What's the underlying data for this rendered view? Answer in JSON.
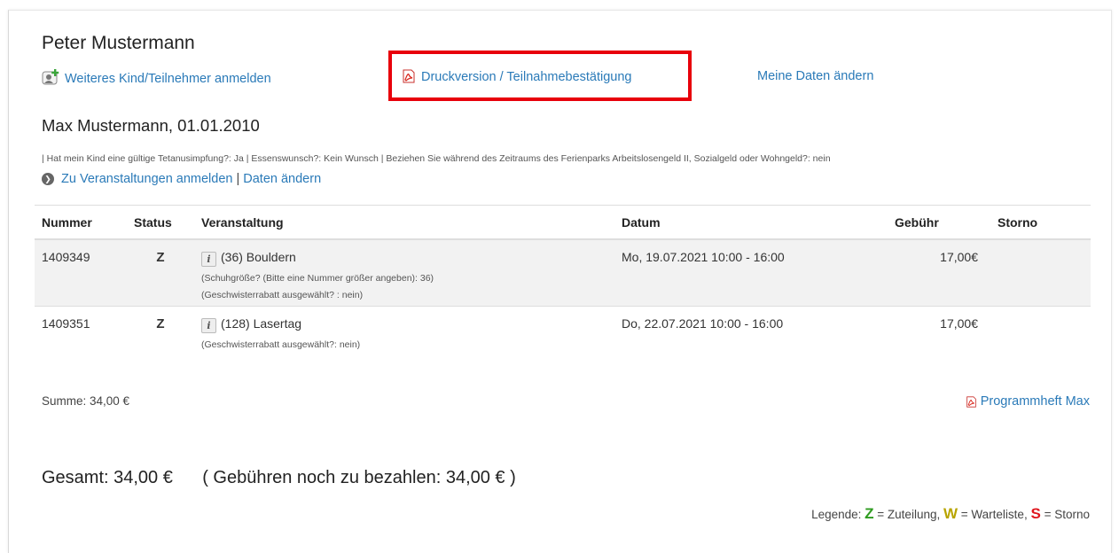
{
  "parent": {
    "name": "Peter Mustermann",
    "actions": {
      "add_child": "Weiteres Kind/Teilnehmer anmelden",
      "print": "Druckversion / Teilnahmebestätigung",
      "my_data": "Meine Daten ändern"
    }
  },
  "child": {
    "name": "Max Mustermann, 01.01.2010",
    "info": "| Hat mein Kind eine gültige Tetanusimpfung?: Ja | Essenswunsch?: Kein Wunsch | Beziehen Sie während des Zeitraums des Ferienparks Arbeitslosengeld II, Sozialgeld oder Wohngeld?: nein",
    "link_register": "Zu Veranstaltungen anmelden",
    "link_separator": "|",
    "link_edit": "Daten ändern"
  },
  "table": {
    "headers": {
      "nummer": "Nummer",
      "status": "Status",
      "veranstaltung": "Veranstaltung",
      "datum": "Datum",
      "gebuehr": "Gebühr",
      "storno": "Storno"
    },
    "rows": [
      {
        "nummer": "1409349",
        "status": "Z",
        "veranstaltung": "(36) Bouldern",
        "notes": [
          "(Schuhgröße? (Bitte eine Nummer größer angeben): 36)",
          "(Geschwisterrabatt ausgewählt? : nein)"
        ],
        "datum": "Mo, 19.07.2021 10:00 - 16:00",
        "gebuehr": "17,00€",
        "storno": ""
      },
      {
        "nummer": "1409351",
        "status": "Z",
        "veranstaltung": "(128) Lasertag",
        "notes": [
          "(Geschwisterrabatt ausgewählt?: nein)"
        ],
        "datum": "Do, 22.07.2021 10:00 - 16:00",
        "gebuehr": "17,00€",
        "storno": ""
      }
    ]
  },
  "summe": "Summe: 34,00 €",
  "programmheft": "Programmheft Max",
  "gesamt": "Gesamt: 34,00 €      ( Gebühren noch zu bezahlen: 34,00 € )",
  "legend": {
    "prefix": "Legende:",
    "z": "Z",
    "z_text": "= Zuteilung,",
    "w": "W",
    "w_text": "= Warteliste,",
    "s": "S",
    "s_text": "= Storno"
  },
  "colors": {
    "link": "#2a7ab8",
    "status_z": "#2e9b1f",
    "status_w": "#b8a400",
    "status_s": "#e0161e",
    "highlight": "#e8000b"
  },
  "icons": [
    "add-user-icon",
    "pdf-icon",
    "arrow-circle-icon",
    "info-icon"
  ]
}
